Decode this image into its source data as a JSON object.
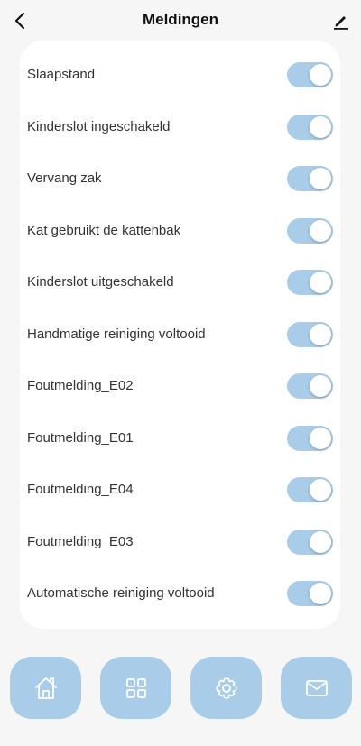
{
  "header": {
    "title": "Meldingen",
    "back_icon": "chevron-left-icon",
    "edit_icon": "pencil-icon"
  },
  "colors": {
    "background": "#f6f6f6",
    "card": "#ffffff",
    "accent": "#a9cde8",
    "icon_stroke": "#ffffff"
  },
  "settings": [
    {
      "label": "Slaapstand",
      "enabled": true
    },
    {
      "label": "Kinderslot ingeschakeld",
      "enabled": true
    },
    {
      "label": "Vervang zak",
      "enabled": true
    },
    {
      "label": "Kat gebruikt de kattenbak",
      "enabled": true
    },
    {
      "label": "Kinderslot uitgeschakeld",
      "enabled": true
    },
    {
      "label": "Handmatige reiniging voltooid",
      "enabled": true
    },
    {
      "label": "Foutmelding_E02",
      "enabled": true
    },
    {
      "label": "Foutmelding_E01",
      "enabled": true
    },
    {
      "label": "Foutmelding_E04",
      "enabled": true
    },
    {
      "label": "Foutmelding_E03",
      "enabled": true
    },
    {
      "label": "Automatische reiniging voltooid",
      "enabled": true
    }
  ],
  "tabbar": {
    "tabs": [
      {
        "icon": "home-icon"
      },
      {
        "icon": "grid-icon"
      },
      {
        "icon": "gear-icon"
      },
      {
        "icon": "mail-icon"
      }
    ]
  }
}
